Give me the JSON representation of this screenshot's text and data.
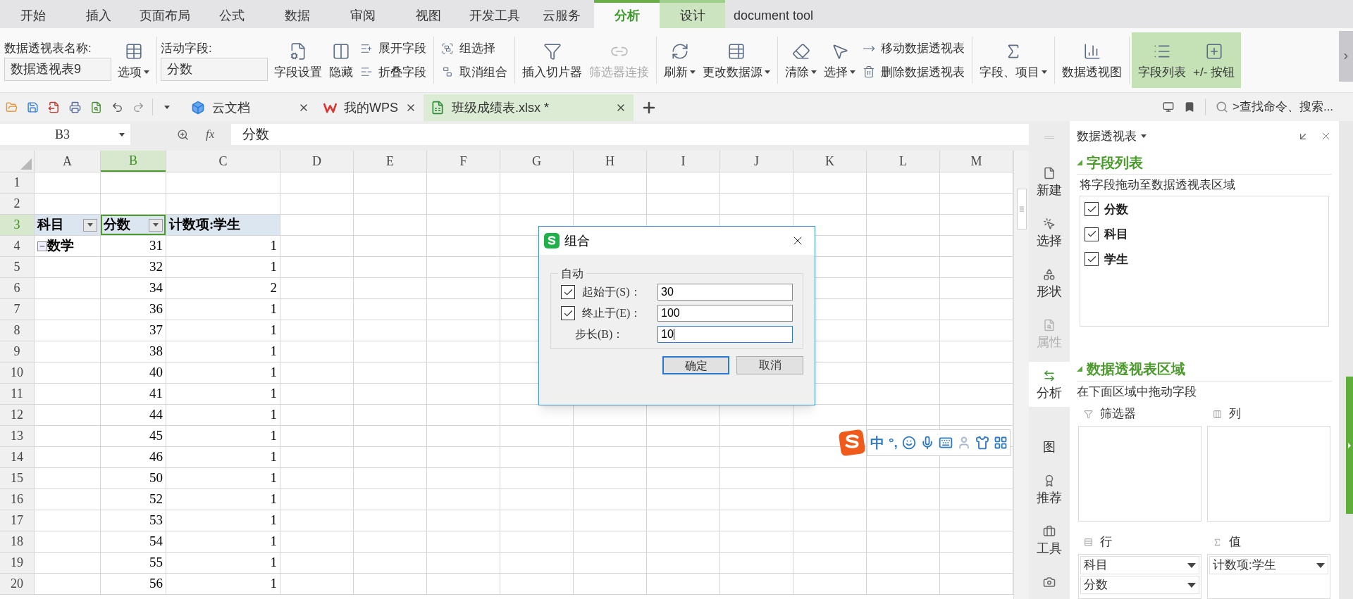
{
  "menu_tabs": [
    {
      "label": "开始",
      "selected": false,
      "kind": "plain"
    },
    {
      "label": "插入",
      "selected": false,
      "kind": "plain"
    },
    {
      "label": "页面布局",
      "selected": false,
      "kind": "plain"
    },
    {
      "label": "公式",
      "selected": false,
      "kind": "plain"
    },
    {
      "label": "数据",
      "selected": false,
      "kind": "plain"
    },
    {
      "label": "审阅",
      "selected": false,
      "kind": "plain"
    },
    {
      "label": "视图",
      "selected": false,
      "kind": "plain"
    },
    {
      "label": "开发工具",
      "selected": false,
      "kind": "plain"
    },
    {
      "label": "云服务",
      "selected": false,
      "kind": "plain"
    },
    {
      "label": "分析",
      "selected": true,
      "kind": "context"
    },
    {
      "label": "设计",
      "selected": false,
      "kind": "context"
    },
    {
      "label": "document tool",
      "selected": false,
      "kind": "plain"
    }
  ],
  "ribbon": {
    "groups": [
      {
        "items": [
          {
            "kind": "field",
            "label": "数据透视表名称:",
            "value": "数据透视表9"
          },
          {
            "kind": "large",
            "label": "选项",
            "dropdown": true,
            "disabled": false
          }
        ]
      },
      {
        "items": [
          {
            "kind": "field",
            "label": "活动字段:",
            "value": "分数"
          },
          {
            "kind": "large",
            "label": "字段设置",
            "dropdown": false,
            "disabled": false
          },
          {
            "kind": "large",
            "label": "隐藏",
            "dropdown": false,
            "disabled": false
          },
          {
            "kind": "stack",
            "items": [
              {
                "label": "展开字段",
                "disabled": false
              },
              {
                "label": "折叠字段",
                "disabled": false
              }
            ]
          }
        ]
      },
      {
        "items": [
          {
            "kind": "stack",
            "items": [
              {
                "label": "组选择",
                "disabled": false
              },
              {
                "label": "取消组合",
                "disabled": false
              }
            ]
          }
        ]
      },
      {
        "items": [
          {
            "kind": "large",
            "label": "插入切片器",
            "dropdown": false,
            "disabled": false
          },
          {
            "kind": "large",
            "label": "筛选器连接",
            "dropdown": false,
            "disabled": true
          }
        ]
      },
      {
        "items": [
          {
            "kind": "large",
            "label": "刷新",
            "dropdown": true,
            "disabled": false
          },
          {
            "kind": "large",
            "label": "更改数据源",
            "dropdown": true,
            "disabled": false
          }
        ]
      },
      {
        "items": [
          {
            "kind": "large",
            "label": "清除",
            "dropdown": true,
            "disabled": false
          },
          {
            "kind": "large",
            "label": "选择",
            "dropdown": true,
            "disabled": false
          },
          {
            "kind": "stack",
            "items": [
              {
                "label": "移动数据透视表",
                "disabled": false
              },
              {
                "label": "删除数据透视表",
                "disabled": false
              }
            ]
          }
        ]
      },
      {
        "items": [
          {
            "kind": "large",
            "label": "字段、项目",
            "dropdown": true,
            "disabled": false
          }
        ]
      },
      {
        "items": [
          {
            "kind": "large",
            "label": "数据透视图",
            "dropdown": false,
            "disabled": false
          }
        ]
      },
      {
        "highlighted": true,
        "items": [
          {
            "kind": "large",
            "label": "字段列表",
            "dropdown": false,
            "disabled": false
          },
          {
            "kind": "large",
            "label": "+/- 按钮",
            "dropdown": false,
            "disabled": false
          }
        ]
      }
    ]
  },
  "doc_tabs": [
    {
      "label": "云文档",
      "selected": false
    },
    {
      "label": "我的WPS",
      "selected": false
    },
    {
      "label": "班级成绩表.xlsx *",
      "selected": true
    }
  ],
  "search": {
    "placeholder": ">查找命令、搜索..."
  },
  "formula_bar": {
    "cell": "B3",
    "function_label": "fx",
    "formula": "分数"
  },
  "sheet": {
    "columns": [
      {
        "label": "A",
        "selected": false
      },
      {
        "label": "B",
        "selected": true
      },
      {
        "label": "C",
        "selected": false
      },
      {
        "label": "D",
        "selected": false
      },
      {
        "label": "E",
        "selected": false
      },
      {
        "label": "F",
        "selected": false
      },
      {
        "label": "G",
        "selected": false
      },
      {
        "label": "H",
        "selected": false
      },
      {
        "label": "I",
        "selected": false
      },
      {
        "label": "J",
        "selected": false
      },
      {
        "label": "K",
        "selected": false
      },
      {
        "label": "L",
        "selected": false
      },
      {
        "label": "M",
        "selected": false
      }
    ],
    "rows": [
      {
        "number": "1",
        "selected": false,
        "kind": "empty"
      },
      {
        "number": "2",
        "selected": false,
        "kind": "empty"
      },
      {
        "number": "3",
        "selected": true,
        "kind": "header",
        "cells": [
          {
            "text": "科目",
            "filter": true
          },
          {
            "text": "分数",
            "filter": true
          },
          {
            "text": "计数项:学生",
            "filter": false
          }
        ]
      },
      {
        "number": "4",
        "selected": false,
        "kind": "group",
        "label": "数学",
        "expanded": true,
        "score": "31",
        "count": "1"
      },
      {
        "number": "5",
        "selected": false,
        "kind": "data",
        "score": "32",
        "count": "1"
      },
      {
        "number": "6",
        "selected": false,
        "kind": "data",
        "score": "34",
        "count": "2"
      },
      {
        "number": "7",
        "selected": false,
        "kind": "data",
        "score": "36",
        "count": "1"
      },
      {
        "number": "8",
        "selected": false,
        "kind": "data",
        "score": "37",
        "count": "1"
      },
      {
        "number": "9",
        "selected": false,
        "kind": "data",
        "score": "38",
        "count": "1"
      },
      {
        "number": "10",
        "selected": false,
        "kind": "data",
        "score": "40",
        "count": "1"
      },
      {
        "number": "11",
        "selected": false,
        "kind": "data",
        "score": "41",
        "count": "1"
      },
      {
        "number": "12",
        "selected": false,
        "kind": "data",
        "score": "44",
        "count": "1"
      },
      {
        "number": "13",
        "selected": false,
        "kind": "data",
        "score": "45",
        "count": "1"
      },
      {
        "number": "14",
        "selected": false,
        "kind": "data",
        "score": "46",
        "count": "1"
      },
      {
        "number": "15",
        "selected": false,
        "kind": "data",
        "score": "50",
        "count": "1"
      },
      {
        "number": "16",
        "selected": false,
        "kind": "data",
        "score": "52",
        "count": "1"
      },
      {
        "number": "17",
        "selected": false,
        "kind": "data",
        "score": "53",
        "count": "1"
      },
      {
        "number": "18",
        "selected": false,
        "kind": "data",
        "score": "54",
        "count": "1"
      },
      {
        "number": "19",
        "selected": false,
        "kind": "data",
        "score": "55",
        "count": "1"
      },
      {
        "number": "20",
        "selected": false,
        "kind": "data",
        "score": "56",
        "count": "1"
      }
    ]
  },
  "dialog": {
    "title": "组合",
    "group_label": "自动",
    "fields": [
      {
        "kind": "checkbox",
        "label": "起始于(S)：",
        "checked": true,
        "value": "30",
        "focused": false
      },
      {
        "kind": "checkbox",
        "label": "终止于(E)：",
        "checked": true,
        "value": "100",
        "focused": false
      },
      {
        "kind": "plain",
        "label": "步长(B)：",
        "value": "10",
        "focused": true
      }
    ],
    "buttons": [
      {
        "label": "确定",
        "default": true
      },
      {
        "label": "取消",
        "default": false
      }
    ]
  },
  "ime_bar": {
    "mode": "中",
    "punctuation": "°,"
  },
  "side_bar": [
    {
      "label": "新建",
      "selected": false,
      "disabled": false
    },
    {
      "label": "选择",
      "selected": false,
      "disabled": false
    },
    {
      "label": "形状",
      "selected": false,
      "disabled": false
    },
    {
      "label": "属性",
      "selected": false,
      "disabled": true
    },
    {
      "label": "分析",
      "selected": true,
      "disabled": false
    },
    {
      "label": "图",
      "selected": false,
      "disabled": false
    },
    {
      "label": "推荐",
      "selected": false,
      "disabled": false
    },
    {
      "label": "工具",
      "selected": false,
      "disabled": false
    },
    {
      "selected": false,
      "disabled": false
    }
  ],
  "panel": {
    "title": "数据透视表",
    "field_section": {
      "title": "字段列表",
      "expanded": true,
      "hint": "将字段拖动至数据透视表区域",
      "fields": [
        {
          "label": "分数",
          "checked": true
        },
        {
          "label": "科目",
          "checked": true
        },
        {
          "label": "学生",
          "checked": true
        }
      ]
    },
    "area_section": {
      "title": "数据透视表区域",
      "expanded": true,
      "hint": "在下面区域中拖动字段",
      "areas": [
        {
          "label": "筛选器"
        },
        {
          "label": "列"
        },
        {
          "label": "行",
          "items": [
            "科目",
            "分数"
          ]
        },
        {
          "label": "值",
          "items": [
            "计数项:学生"
          ]
        }
      ]
    }
  }
}
